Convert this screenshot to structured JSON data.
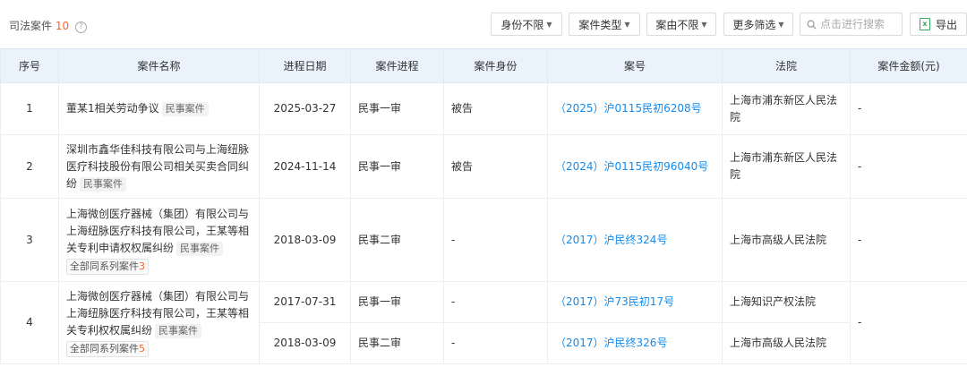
{
  "toolbar": {
    "title": "司法案件",
    "count": "10",
    "filters": [
      {
        "label": "身份不限"
      },
      {
        "label": "案件类型"
      },
      {
        "label": "案由不限"
      },
      {
        "label": "更多筛选"
      }
    ],
    "search_placeholder": "点击进行搜索",
    "export_label": "导出"
  },
  "table": {
    "headers": [
      "序号",
      "案件名称",
      "进程日期",
      "案件进程",
      "案件身份",
      "案号",
      "法院",
      "案件金额(元)"
    ],
    "rows": [
      {
        "index": "1",
        "name": "董某1相关劳动争议",
        "tag": "民事案件",
        "date": "2025-03-27",
        "stage": "民事一审",
        "role": "被告",
        "case_no": "（2025）沪0115民初6208号",
        "court": "上海市浦东新区人民法院",
        "amount": "-"
      },
      {
        "index": "2",
        "name": "深圳市鑫华佳科技有限公司与上海纽脉医疗科技股份有限公司相关买卖合同纠纷",
        "tag": "民事案件",
        "date": "2024-11-14",
        "stage": "民事一审",
        "role": "被告",
        "case_no": "（2024）沪0115民初96040号",
        "court": "上海市浦东新区人民法院",
        "amount": "-"
      },
      {
        "index": "3",
        "name": "上海微创医疗器械（集团）有限公司与上海纽脉医疗科技有限公司，王某等相关专利申请权权属纠纷",
        "tag": "民事案件",
        "series_label": "全部同系列案件",
        "series_count": "3",
        "date": "2018-03-09",
        "stage": "民事二审",
        "role": "-",
        "case_no": "（2017）沪民终324号",
        "court": "上海市高级人民法院",
        "amount": "-"
      },
      {
        "index": "4",
        "name": "上海微创医疗器械（集团）有限公司与上海纽脉医疗科技有限公司，王某等相关专利权权属纠纷",
        "tag": "民事案件",
        "series_label": "全部同系列案件",
        "series_count": "5",
        "amount": "-",
        "sub": [
          {
            "date": "2017-07-31",
            "stage": "民事一审",
            "role": "-",
            "case_no": "（2017）沪73民初17号",
            "court": "上海知识产权法院"
          },
          {
            "date": "2018-03-09",
            "stage": "民事二审",
            "role": "-",
            "case_no": "（2017）沪民终326号",
            "court": "上海市高级人民法院"
          }
        ]
      }
    ]
  }
}
